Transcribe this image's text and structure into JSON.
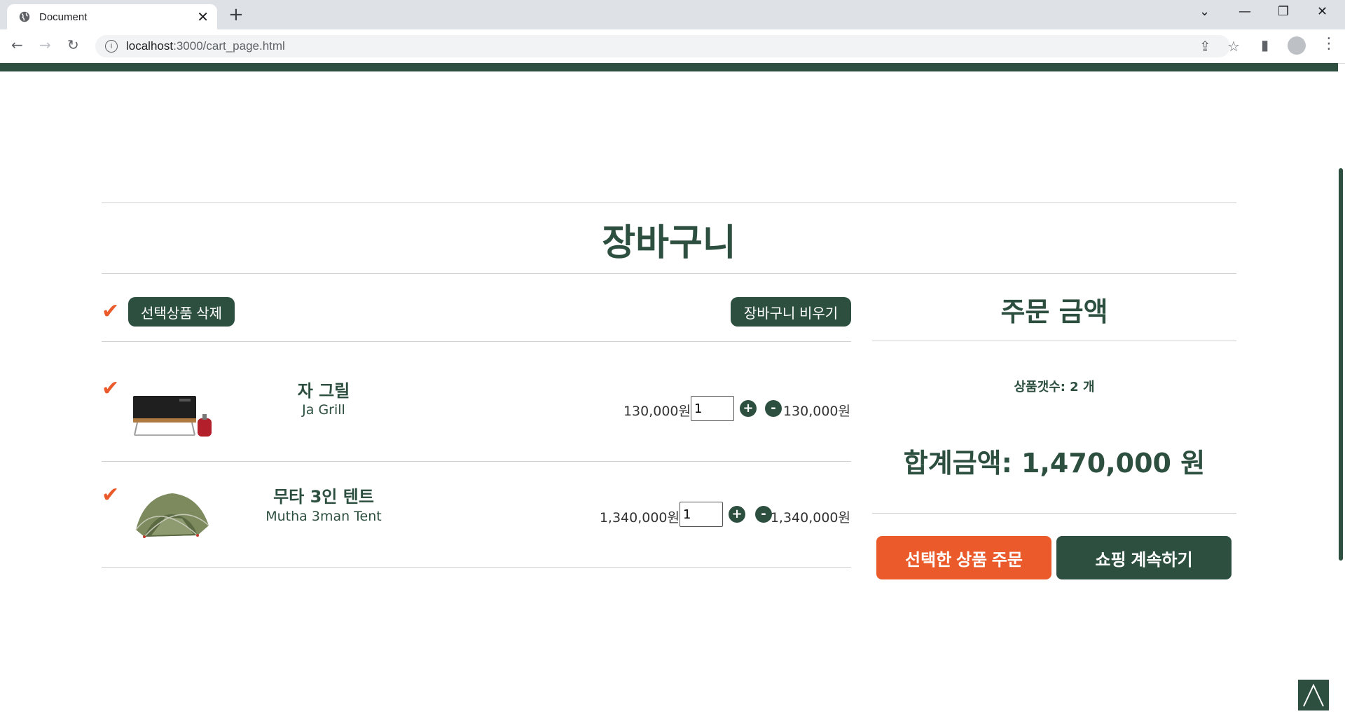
{
  "browser": {
    "tab_title": "Document",
    "url_host": "localhost",
    "url_rest": ":3000/cart_page.html"
  },
  "page": {
    "title": "장바구니",
    "toolbar": {
      "delete_selected_label": "선택상품 삭제",
      "empty_cart_label": "장바구니 비우기"
    },
    "items": [
      {
        "name_ko": "자 그릴",
        "name_en": "Ja Grill",
        "unit_price": "130,000원",
        "quantity": "1",
        "line_total": "130,000원",
        "image_icon": "grill-image"
      },
      {
        "name_ko": "무타 3인 텐트",
        "name_en": "Mutha 3man Tent",
        "unit_price": "1,340,000원",
        "quantity": "1",
        "line_total": "1,340,000원",
        "image_icon": "tent-image"
      }
    ],
    "summary": {
      "title": "주문 금액",
      "count_text": "상품갯수: 2 개",
      "total_text": "합계금액: 1,470,000 원",
      "order_button_label": "선택한 상품 주문",
      "continue_button_label": "쇼핑 계속하기"
    },
    "colors": {
      "brand_green": "#2d4f3f",
      "accent_orange": "#ea5a2b"
    }
  }
}
